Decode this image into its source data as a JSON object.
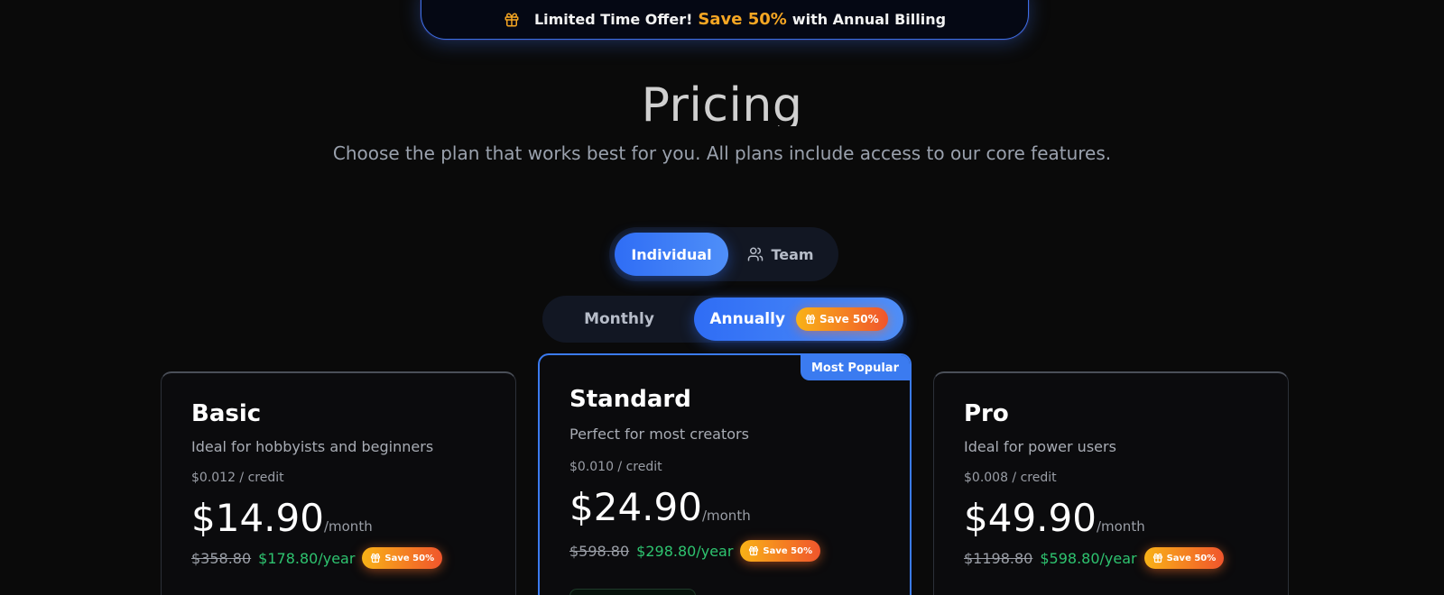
{
  "promo": {
    "prefix": "Limited Time Offer!",
    "highlight": "Save 50%",
    "suffix": "with Annual Billing",
    "accent_color": "#f5a623"
  },
  "header": {
    "title": "Pricing",
    "subtitle": "Choose the plan that works best for you. All plans include access to our core features."
  },
  "audience_toggle": {
    "options": [
      "Individual",
      "Team"
    ],
    "selected": "Individual"
  },
  "billing_toggle": {
    "options": [
      "Monthly",
      "Annually"
    ],
    "selected": "Annually",
    "badge": "Save 50%"
  },
  "plans": [
    {
      "name": "Basic",
      "description": "Ideal for hobbyists and beginners",
      "credit_price": "$0.012 / credit",
      "price": "$14.90",
      "period": "/month",
      "original_yearly": "$358.80",
      "yearly": "$178.80/year",
      "badge": "Save 50%"
    },
    {
      "name": "Standard",
      "description": "Perfect for most creators",
      "credit_price": "$0.010 / credit",
      "price": "$24.90",
      "period": "/month",
      "original_yearly": "$598.80",
      "yearly": "$298.80/year",
      "badge": "Save 50%",
      "ribbon": "Most Popular"
    },
    {
      "name": "Pro",
      "description": "Ideal for power users",
      "credit_price": "$0.008 / credit",
      "price": "$49.90",
      "period": "/month",
      "original_yearly": "$1198.80",
      "yearly": "$598.80/year",
      "badge": "Save 50%"
    }
  ],
  "colors": {
    "background": "#0a0a0a",
    "accent_blue": "#3b7bf0",
    "price_green": "#2ec36f",
    "badge_orange": "#f0552c"
  }
}
